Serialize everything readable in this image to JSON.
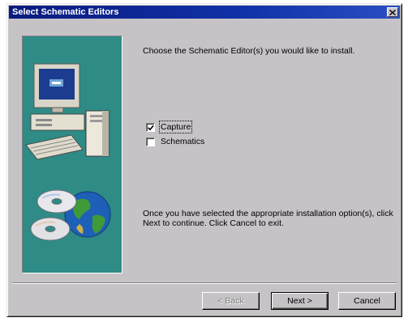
{
  "window": {
    "title": "Select Schematic Editors",
    "close_label": "close"
  },
  "instructions": {
    "intro": "Choose the Schematic Editor(s) you would like to install.",
    "outro": "Once you have selected the appropriate installation option(s), click Next to continue. Click Cancel to exit."
  },
  "options": [
    {
      "label": "Capture",
      "checked": true
    },
    {
      "label": "Schematics",
      "checked": false
    }
  ],
  "buttons": {
    "back": "< Back",
    "next": "Next >",
    "cancel": "Cancel"
  },
  "icons": {
    "art": "computer-and-cds-globe-illustration",
    "close": "close-icon"
  },
  "colors": {
    "titlebar": "#0a1a7e",
    "face": "#c6c3c6",
    "art_panel": "#2e8b86"
  }
}
